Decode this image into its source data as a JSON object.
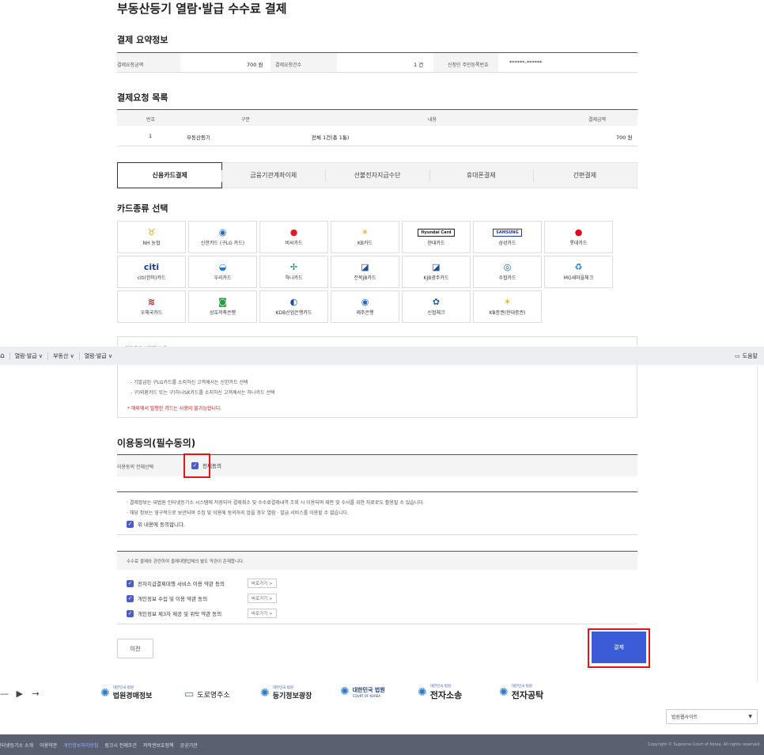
{
  "page_title": "부동산등기 열람·발급 수수료 결제",
  "summary": {
    "title": "결제 요약정보",
    "amount_label": "결제요청금액",
    "amount_value": "700 원",
    "count_label": "결제요청건수",
    "count_value": "1 건",
    "id_label": "신청인 주민등록번호",
    "id_value": "******-******"
  },
  "request_list": {
    "title": "결제요청 목록",
    "headers": [
      "번호",
      "구분",
      "내용",
      "결제금액"
    ],
    "rows": [
      [
        "1",
        "부동산등기",
        "전체 1건(총 1통)",
        "700 원"
      ]
    ]
  },
  "payment_tabs": [
    "신용카드결제",
    "금융기관계좌이체",
    "선불전자지급수단",
    "휴대폰결제",
    "간편결제"
  ],
  "card_section": {
    "title": "카드종류 선택",
    "cards": [
      {
        "label": "NH 농협",
        "icon": "nh-icon",
        "glyph": "♉",
        "color": "#e8a100"
      },
      {
        "label": "신한카드 (구LG 카드)",
        "icon": "shinhan-icon",
        "glyph": "◉",
        "color": "#1f6bc2"
      },
      {
        "label": "비씨카드",
        "icon": "bc-icon",
        "glyph": "●",
        "color": "#e21b2a"
      },
      {
        "label": "KB카드",
        "icon": "kb-icon",
        "glyph": "✶",
        "color": "#f2b400"
      },
      {
        "label": "현대카드",
        "icon": "hyundai-icon",
        "glyph": "Hyundai Card",
        "color": "#222222"
      },
      {
        "label": "삼성카드",
        "icon": "samsung-icon",
        "glyph": "SAMSUNG",
        "color": "#1a3c98"
      },
      {
        "label": "롯데카드",
        "icon": "lotte-icon",
        "glyph": "●",
        "color": "#e2001a"
      },
      {
        "label": "citi(한미)카드",
        "icon": "citi-icon",
        "glyph": "citi",
        "color": "#1b3f8f"
      },
      {
        "label": "우리카드",
        "icon": "woori-icon",
        "glyph": "◒",
        "color": "#1a7ad4"
      },
      {
        "label": "하나카드",
        "icon": "hana-icon",
        "glyph": "✢",
        "color": "#00847a"
      },
      {
        "label": "전북JB카드",
        "icon": "jb-icon",
        "glyph": "◪",
        "color": "#1b4f9c"
      },
      {
        "label": "KJB광주카드",
        "icon": "kjb-icon",
        "glyph": "◪",
        "color": "#1b4f9c"
      },
      {
        "label": "수협카드",
        "icon": "suhyup-icon",
        "glyph": "◎",
        "color": "#1a5fb4"
      },
      {
        "label": "MG새마을체크",
        "icon": "mg-icon",
        "glyph": "♻",
        "color": "#1e7fc7"
      },
      {
        "label": "우체국카드",
        "icon": "post-icon",
        "glyph": "≋",
        "color": "#e2001a"
      },
      {
        "label": "상호저축은행",
        "icon": "savings-icon",
        "glyph": "◙",
        "color": "#2e9a3e"
      },
      {
        "label": "KDB산업은행카드",
        "icon": "kdb-icon",
        "glyph": "◐",
        "color": "#1a4f9c"
      },
      {
        "label": "제주은행",
        "icon": "jeju-icon",
        "glyph": "◉",
        "color": "#1f6bc2"
      },
      {
        "label": "신협체크",
        "icon": "shinhyup-icon",
        "glyph": "✿",
        "color": "#1a5fb4"
      },
      {
        "label": "KB증권(현대증권)",
        "icon": "kbsec-icon",
        "glyph": "✶",
        "color": "#f2b400"
      }
    ]
  },
  "notice": {
    "heading": "카드종류 선택하시 후",
    "lines": [
      "- 기발급된 구LG카드를 소지하신 고객께서는 신한카드 선택",
      "- 구)외환카드 또는 구)하나SK카드를 소지하신 고객께서는 하나카드 선택"
    ],
    "warning": "* 해외에서 발행한 카드는 사용이 불가능합니다."
  },
  "topbar": {
    "breadcrumbs": [
      "열람·발급 ∨",
      "부동산 ∨",
      "열람·발급 ∨"
    ],
    "help": "도움말"
  },
  "consent": {
    "title": "이용동의(필수동의)",
    "all_label": "이용동의 전체선택",
    "all_check": "전체동의",
    "info_lines": [
      "· 결제정보는 대법원 인터넷등기소 시스템에 저장되어 결제취소 및 수수료결제내역 조회 시 이용되며 재판 및 수사를 위한 자료로도 활용될 수 있습니다.",
      "· 해당 정보는 영구적으로 보관되며 수집 및 이용에 동의하지 않을 경우 열람 · 발급 서비스를 이용할 수 없습니다."
    ],
    "agree_label": "위 내용에 동의합니다.",
    "terms_note": "수수료 결제와 관련하여 결제대행업체의 별도 약관이 존재합니다.",
    "terms": [
      "전자지급결제대행 서비스 이용 약관 동의",
      "개인정보 수집 및 이용 약관 동의",
      "개인정보 제3자 제공 및 위탁 약관 동의"
    ],
    "goto_label": "바로가기 >"
  },
  "buttons": {
    "prev": "이전",
    "pay": "결제"
  },
  "footer": {
    "logos": [
      "법원경매정보",
      "도로명주소",
      "등기정보광장",
      "대한민국 법원",
      "전자소송",
      "전자공탁"
    ],
    "logo_small": "대한민국 법원",
    "court_sub": "COURT OF KOREA",
    "site_select": "법원웹사이트",
    "links": [
      "인터넷등기소 소개",
      "이용약관",
      "개인정보처리방침",
      "링크시 전제조건",
      "저작권보호정책",
      "공공기관"
    ],
    "copyright": "Copyright © Supreme Court of Korea. All rights reserved."
  }
}
